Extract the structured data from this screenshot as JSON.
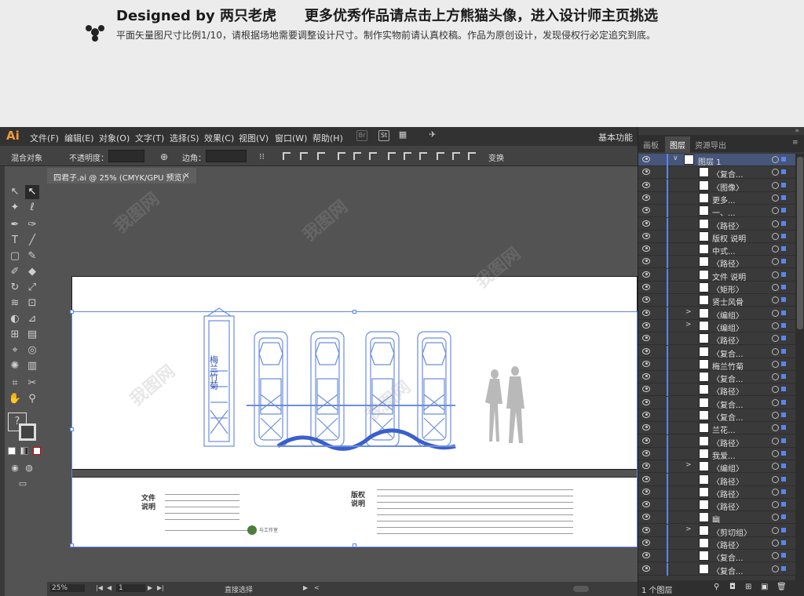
{
  "banner": {
    "title": "Designed by 两只老虎",
    "title2": "更多优秀作品请点击上方熊猫头像，进入设计师主页挑选",
    "subtitle": "平面矢量图尺寸比例1/10，请根据场地需要调整设计尺寸。制作实物前请认真校稿。作品为原创设计，发现侵权行必定追究到底。"
  },
  "app": {
    "logo": "Ai",
    "menus": [
      "文件(F)",
      "编辑(E)",
      "对象(O)",
      "文字(T)",
      "选择(S)",
      "效果(C)",
      "视图(V)",
      "窗口(W)",
      "帮助(H)"
    ],
    "menu_icons": [
      "Br",
      "St"
    ],
    "workspace": "基本功能",
    "control": {
      "object_type": "混合对象",
      "opacity_label": "不透明度：",
      "corner_label": "边角：",
      "transform_label": "变换"
    },
    "doc_tab": {
      "title": "四君子.ai @ 25% (CMYK/GPU 预览)",
      "close": "×"
    },
    "status": {
      "zoom": "25%",
      "page": "1",
      "tool": "直接选择"
    }
  },
  "artboard_doc": {
    "label_left": "文件说明",
    "label_right": "版权说明",
    "site_label": "与工作室"
  },
  "panel": {
    "tabs": [
      "画板",
      "图层",
      "资源导出"
    ],
    "active_tab": "图层",
    "layers": [
      {
        "name": "图层 1",
        "arrow": "∨"
      },
      {
        "name": "〈复合...",
        "arrow": ""
      },
      {
        "name": "〈图像〉",
        "arrow": ""
      },
      {
        "name": "更多...",
        "arrow": ""
      },
      {
        "name": "一、...",
        "arrow": ""
      },
      {
        "name": "〈路径〉",
        "arrow": ""
      },
      {
        "name": "版权 说明",
        "arrow": ""
      },
      {
        "name": "中式...",
        "arrow": ""
      },
      {
        "name": "〈路径〉",
        "arrow": ""
      },
      {
        "name": "文件 说明",
        "arrow": ""
      },
      {
        "name": "〈矩形〉",
        "arrow": ""
      },
      {
        "name": "贤士风骨",
        "arrow": ""
      },
      {
        "name": "〈编组〉",
        "arrow": ">"
      },
      {
        "name": "〈编组〉",
        "arrow": ">"
      },
      {
        "name": "〈路径〉",
        "arrow": ""
      },
      {
        "name": "〈复合...",
        "arrow": ""
      },
      {
        "name": "梅兰竹菊",
        "arrow": ""
      },
      {
        "name": "〈复合...",
        "arrow": ""
      },
      {
        "name": "〈路径〉",
        "arrow": ""
      },
      {
        "name": "〈复合...",
        "arrow": ""
      },
      {
        "name": "〈复合...",
        "arrow": ""
      },
      {
        "name": "兰花...",
        "arrow": ""
      },
      {
        "name": "〈路径〉",
        "arrow": ""
      },
      {
        "name": "我爱...",
        "arrow": ""
      },
      {
        "name": "〈编组〉",
        "arrow": ">"
      },
      {
        "name": "〈路径〉",
        "arrow": ""
      },
      {
        "name": "〈路径〉",
        "arrow": ""
      },
      {
        "name": "〈路径〉",
        "arrow": ""
      },
      {
        "name": "幽",
        "arrow": ""
      },
      {
        "name": "〈剪切组〉",
        "arrow": ">"
      },
      {
        "name": "〈路径〉",
        "arrow": ""
      },
      {
        "name": "〈复合...",
        "arrow": ""
      },
      {
        "name": "〈复合...",
        "arrow": ""
      }
    ],
    "footer": "1 个图层"
  },
  "colors": {
    "accent": "#5b86e8",
    "artwork": "#6a8de0"
  }
}
